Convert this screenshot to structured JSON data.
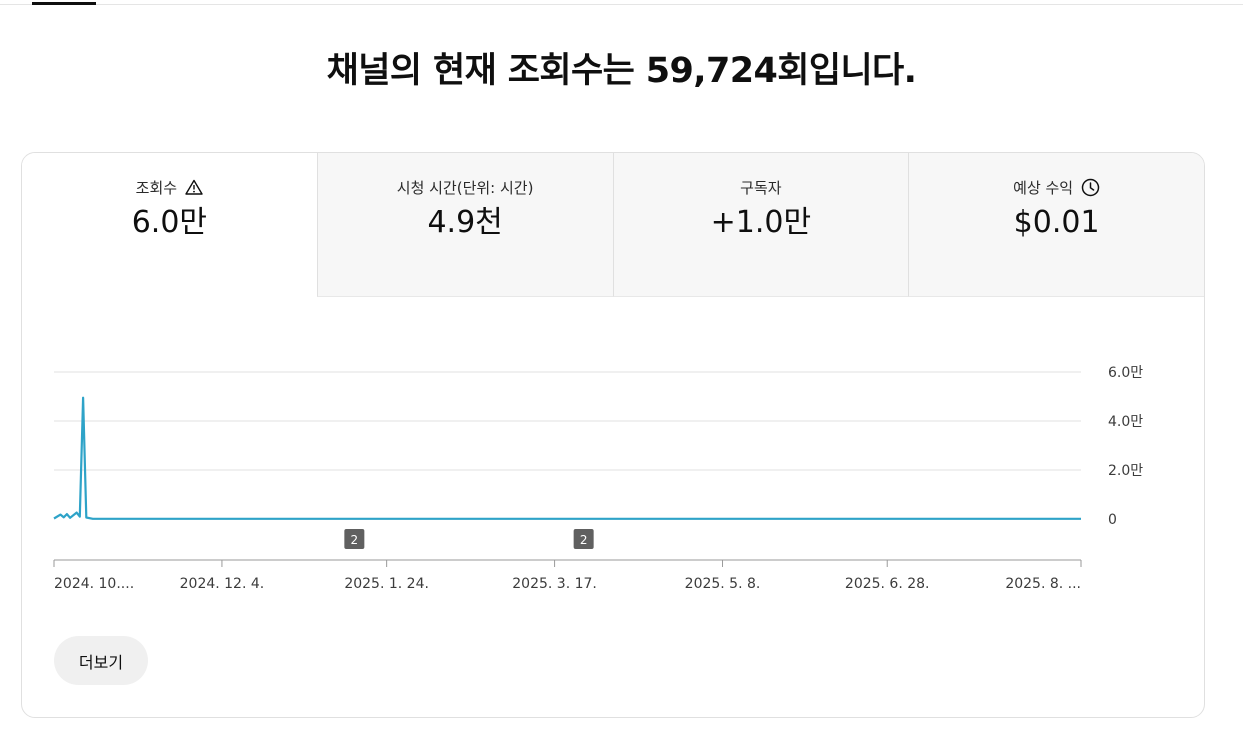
{
  "headline": "채널의 현재 조회수는 59,724회입니다.",
  "metrics": [
    {
      "label": "조회수",
      "value": "6.0만",
      "icon": "warning-icon",
      "active": true
    },
    {
      "label": "시청 시간(단위: 시간)",
      "value": "4.9천",
      "icon": null,
      "active": false
    },
    {
      "label": "구독자",
      "value": "+1.0만",
      "icon": null,
      "active": false
    },
    {
      "label": "예상 수익",
      "value": "$0.01",
      "icon": "clock-icon",
      "active": false
    }
  ],
  "chart_data": {
    "type": "line",
    "title": "",
    "xlabel": "",
    "ylabel": "",
    "ylim": [
      0,
      60000
    ],
    "y_ticks": [
      {
        "value": 60000,
        "label": "6.0만"
      },
      {
        "value": 40000,
        "label": "4.0만"
      },
      {
        "value": 20000,
        "label": "2.0만"
      },
      {
        "value": 0,
        "label": "0"
      }
    ],
    "x_range": [
      "2024-10-13",
      "2025-08-27"
    ],
    "x_ticks": [
      {
        "date": "2024-10-13",
        "label": "2024. 10...."
      },
      {
        "date": "2024-12-04",
        "label": "2024. 12. 4."
      },
      {
        "date": "2025-01-24",
        "label": "2025. 1. 24."
      },
      {
        "date": "2025-03-17",
        "label": "2025. 3. 17."
      },
      {
        "date": "2025-05-08",
        "label": "2025. 5. 8."
      },
      {
        "date": "2025-06-28",
        "label": "2025. 6. 28."
      },
      {
        "date": "2025-08-27",
        "label": "2025. 8. ..."
      }
    ],
    "series": [
      {
        "color": "#2ea3c8",
        "points": [
          [
            "2024-10-13",
            200
          ],
          [
            "2024-10-15",
            1800
          ],
          [
            "2024-10-16",
            700
          ],
          [
            "2024-10-17",
            2000
          ],
          [
            "2024-10-18",
            500
          ],
          [
            "2024-10-20",
            2600
          ],
          [
            "2024-10-21",
            1000
          ],
          [
            "2024-10-22",
            49500
          ],
          [
            "2024-10-23",
            600
          ],
          [
            "2024-10-25",
            100
          ],
          [
            "2025-08-27",
            100
          ]
        ]
      }
    ],
    "annotations": [
      {
        "date": "2025-01-14",
        "label": "2"
      },
      {
        "date": "2025-03-26",
        "label": "2"
      }
    ],
    "grid": true,
    "legend": "none"
  },
  "more_label": "더보기"
}
